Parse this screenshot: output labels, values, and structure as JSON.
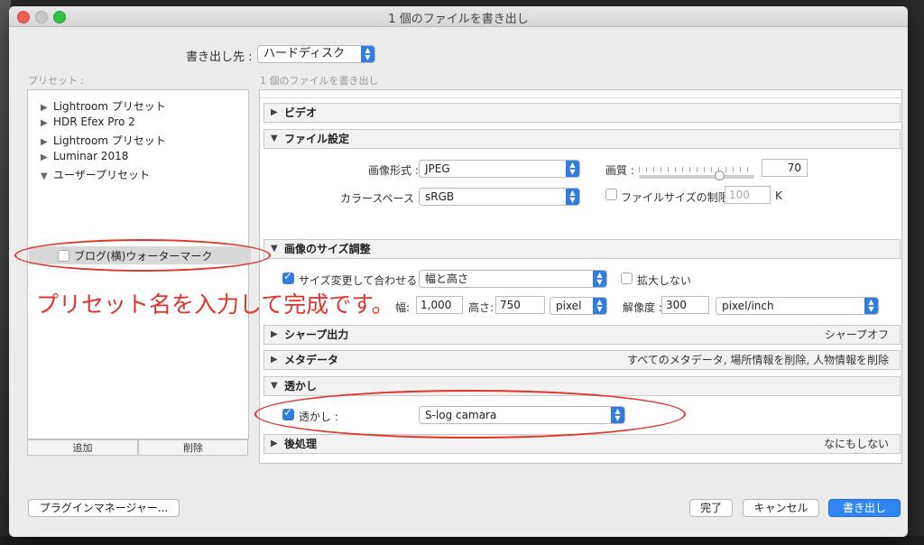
{
  "window": {
    "title": "1 個のファイルを書き出し"
  },
  "export_to": {
    "label": "書き出し先 :",
    "value": "ハードディスク"
  },
  "presets": {
    "label": "プリセット :",
    "items": [
      {
        "label": "Lightroom プリセット"
      },
      {
        "label": "HDR Efex Pro 2"
      },
      {
        "label": "Lightroom プリセット"
      },
      {
        "label": "Luminar 2018"
      },
      {
        "label": "ユーザープリセット"
      }
    ],
    "new_preset_name": "ブログ(横)ウォーターマーク",
    "add_button": "追加",
    "delete_button": "削除"
  },
  "panel_caption": "1 個のファイルを書き出し",
  "sections": {
    "video": {
      "title": "ビデオ"
    },
    "file_settings": {
      "title": "ファイル設定",
      "format_label": "画像形式 :",
      "format_value": "JPEG",
      "quality_label": "画質 :",
      "quality_value": "70",
      "quality_level": 70,
      "colorspace_label": "カラースペース :",
      "colorspace_value": "sRGB",
      "limit_label": "ファイルサイズの制限 :",
      "limit_value": "100",
      "limit_unit": "K"
    },
    "image_sizing": {
      "title": "画像のサイズ調整",
      "resize_label": "サイズ変更して合わせる :",
      "resize_value": "幅と高さ",
      "dont_enlarge_label": "拡大しない",
      "width_label": "幅:",
      "width_value": "1,000",
      "height_label": "高さ:",
      "height_value": "750",
      "unit_value": "pixel",
      "resolution_label": "解像度 :",
      "resolution_value": "300",
      "resolution_unit": "pixel/inch"
    },
    "sharpening": {
      "title": "シャープ出力",
      "summary": "シャープオフ"
    },
    "metadata": {
      "title": "メタデータ",
      "summary": "すべてのメタデータ, 場所情報を削除, 人物情報を削除"
    },
    "watermark": {
      "title": "透かし",
      "checkbox_label": "透かし :",
      "value": "S-log camara"
    },
    "post_processing": {
      "title": "後処理",
      "summary": "なにもしない"
    }
  },
  "annotation": "プリセット名を入力して完成です。",
  "footer": {
    "plugin_manager": "プラグインマネージャー...",
    "done": "完了",
    "cancel": "キャンセル",
    "export": "書き出し"
  },
  "colors": {
    "accent": "#2f7de1",
    "annotation": "#e0352a",
    "primary_button": "#2f86f0"
  }
}
